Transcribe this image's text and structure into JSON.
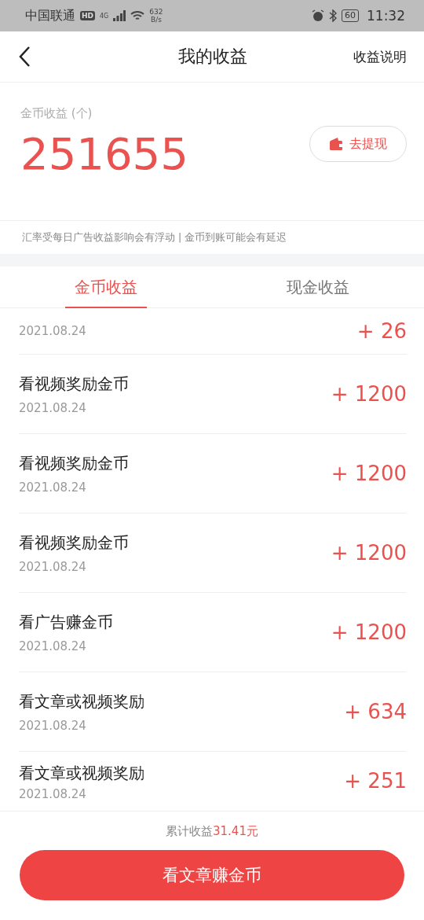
{
  "status_bar": {
    "carrier": "中国联通",
    "network_badge": "HD",
    "network_type": "4G",
    "speed_value": "632",
    "speed_unit": "B/s",
    "battery": "60",
    "time": "11:32"
  },
  "header": {
    "title": "我的收益",
    "action": "收益说明"
  },
  "balance": {
    "label": "金币收益 (个)",
    "value": "251655",
    "withdraw": "去提现"
  },
  "notice": "汇率受每日广告收益影响会有浮动 | 金币到账可能会有延迟",
  "tabs": [
    {
      "label": "金币收益",
      "selected": true
    },
    {
      "label": "现金收益",
      "selected": false
    }
  ],
  "records": [
    {
      "kind": "partial",
      "date": "2021.08.24",
      "amount": "+ 26"
    },
    {
      "kind": "full",
      "title": "看视频奖励金币",
      "date": "2021.08.24",
      "amount": "+ 1200"
    },
    {
      "kind": "full",
      "title": "看视频奖励金币",
      "date": "2021.08.24",
      "amount": "+ 1200"
    },
    {
      "kind": "full",
      "title": "看视频奖励金币",
      "date": "2021.08.24",
      "amount": "+ 1200"
    },
    {
      "kind": "full",
      "title": "看广告赚金币",
      "date": "2021.08.24",
      "amount": "+ 1200"
    },
    {
      "kind": "full",
      "title": "看文章或视频奖励",
      "date": "2021.08.24",
      "amount": "+ 634"
    },
    {
      "kind": "last",
      "title": "看文章或视频奖励",
      "date": "2021.08.24",
      "amount": "+ 251"
    }
  ],
  "footer": {
    "total_label": "累计收益",
    "total_value": "31.41元",
    "button": "看文章赚金币"
  }
}
